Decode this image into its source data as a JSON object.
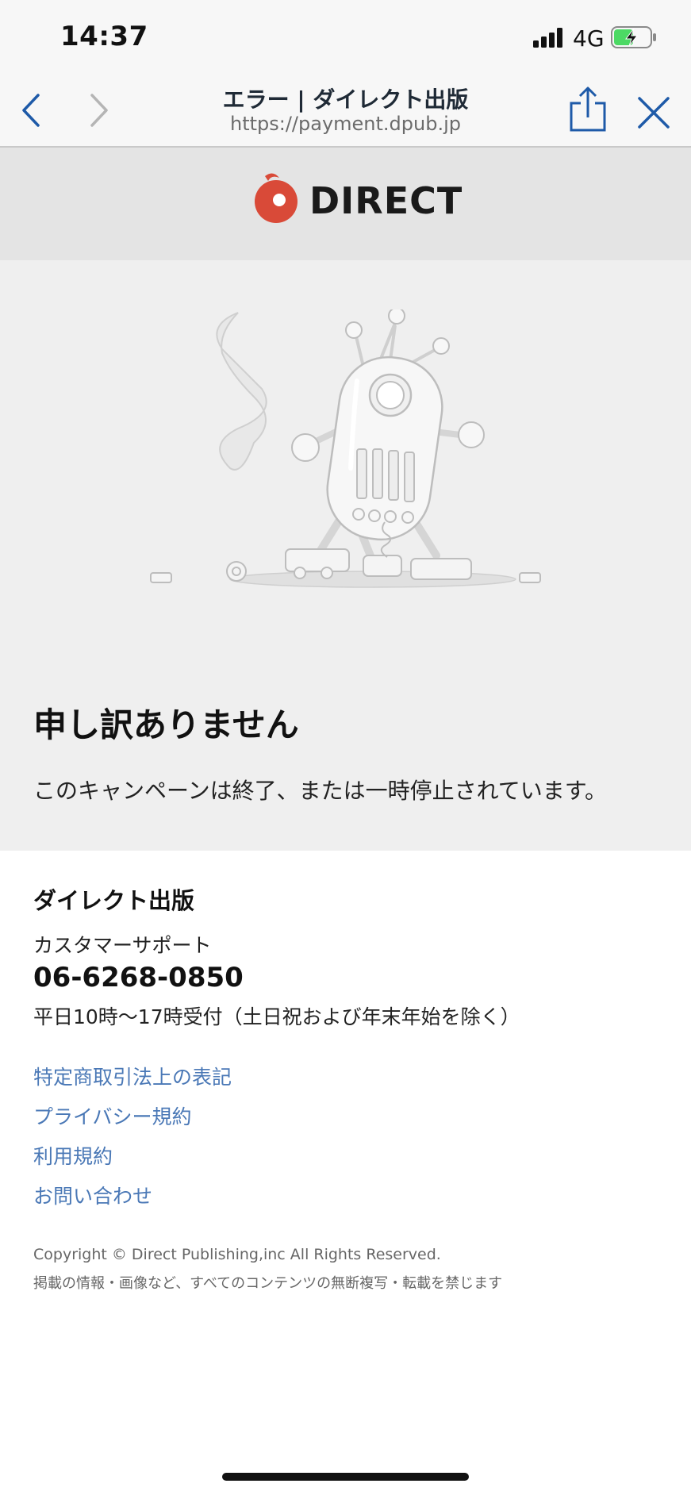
{
  "status_bar": {
    "time": "14:37",
    "network": "4G",
    "icons": [
      "signal-icon",
      "battery-charging-icon"
    ]
  },
  "browser": {
    "title": "エラー | ダイレクト出版",
    "url": "https://payment.dpub.jp",
    "icons": [
      "back-icon",
      "forward-icon",
      "share-icon",
      "close-icon"
    ]
  },
  "header": {
    "logo_text": "DIRECT",
    "accent_color": "#d94a38"
  },
  "error": {
    "heading": "申し訳ありません",
    "message": "このキャンペーンは終了、または一時停止されています。"
  },
  "footer": {
    "company": "ダイレクト出版",
    "support_label": "カスタマーサポート",
    "phone": "06-6268-0850",
    "hours": "平日10時〜17時受付（土日祝および年末年始を除く）",
    "links": [
      "特定商取引法上の表記",
      "プライバシー規約",
      "利用規約",
      "お問い合わせ"
    ],
    "link_color": "#4a78b6",
    "copyright": "Copyright © Direct Publishing,inc All Rights Reserved.",
    "notice": "掲載の情報・画像など、すべてのコンテンツの無断複写・転載を禁じます"
  }
}
